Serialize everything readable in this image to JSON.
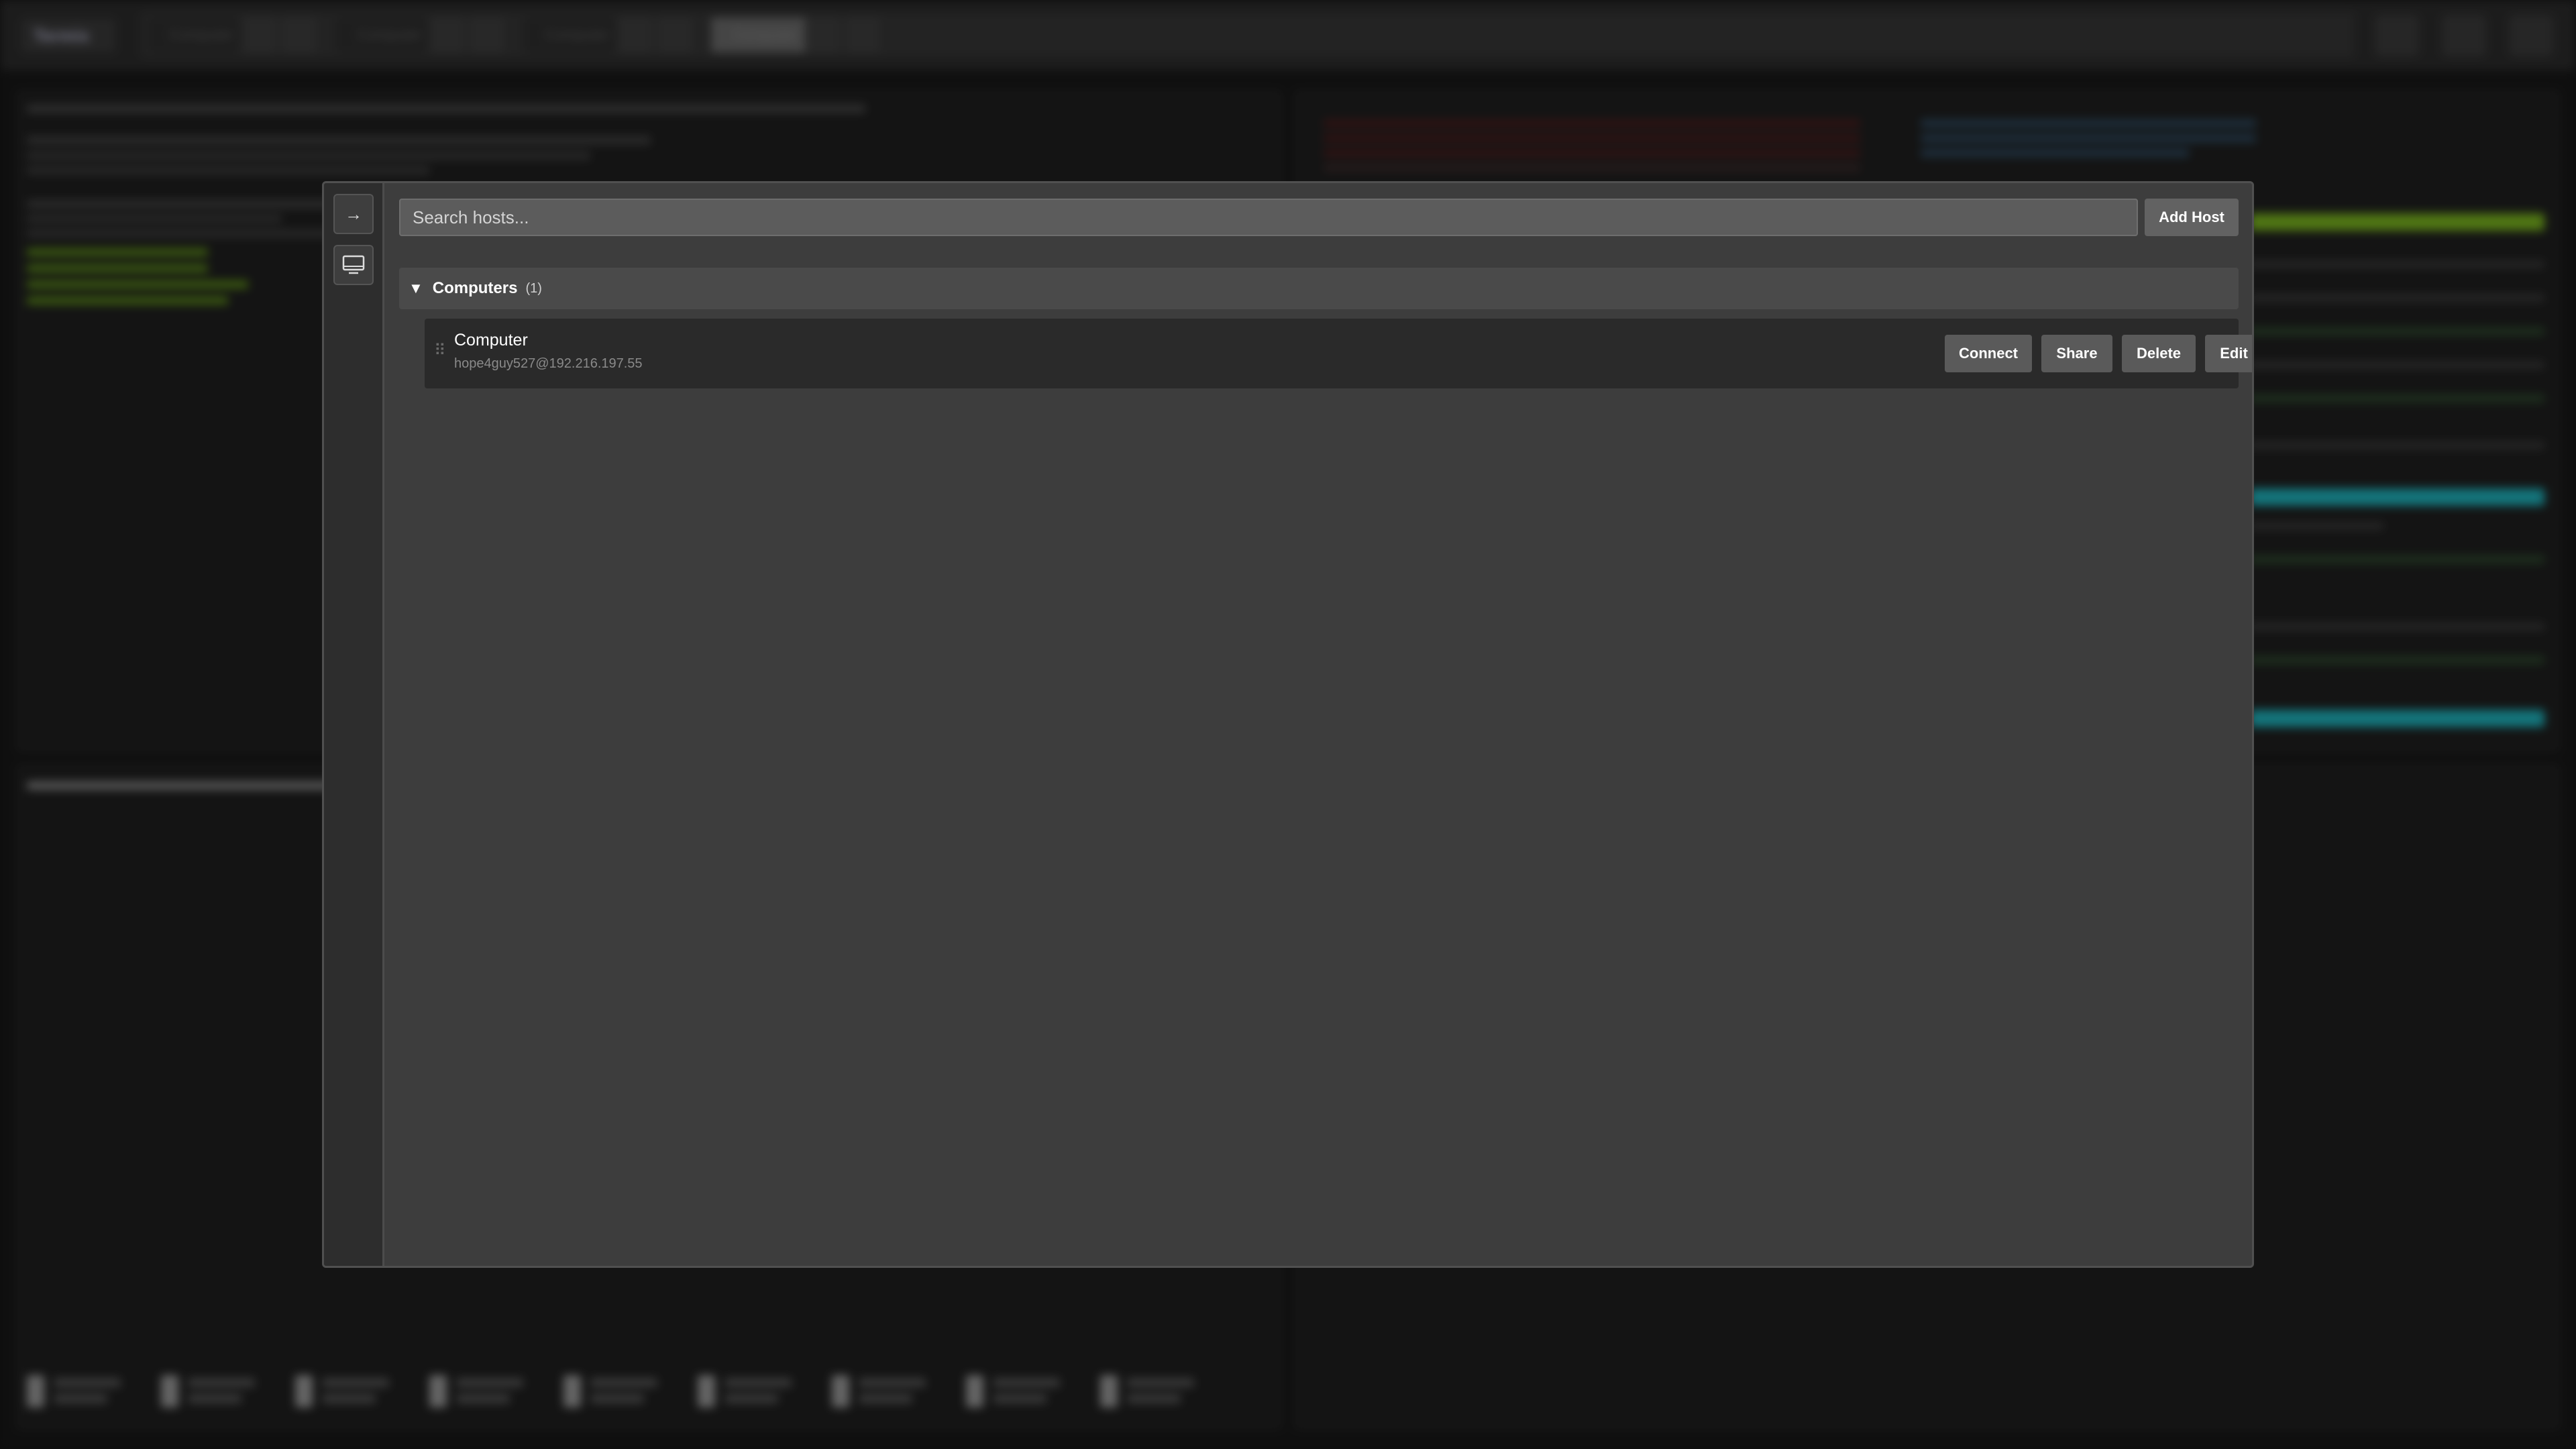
{
  "background": {
    "brand": "Termix",
    "tabs": [
      "Computer",
      "Computer",
      "Computer",
      "Computer"
    ]
  },
  "modal": {
    "search": {
      "placeholder": "Search hosts..."
    },
    "add_host_label": "Add Host",
    "side": {
      "collapse_glyph": "→",
      "host_icon": "monitor-icon"
    },
    "group": {
      "name": "Computers",
      "count": "(1)"
    },
    "host": {
      "name": "Computer",
      "address": "hope4guy527@192.216.197.55",
      "actions": {
        "connect": "Connect",
        "share": "Share",
        "delete": "Delete",
        "edit": "Edit"
      }
    }
  },
  "colors": {
    "modal_bg": "#3d3d3d",
    "accent_green": "#7ab520",
    "accent_cyan": "#1fb3bd"
  }
}
